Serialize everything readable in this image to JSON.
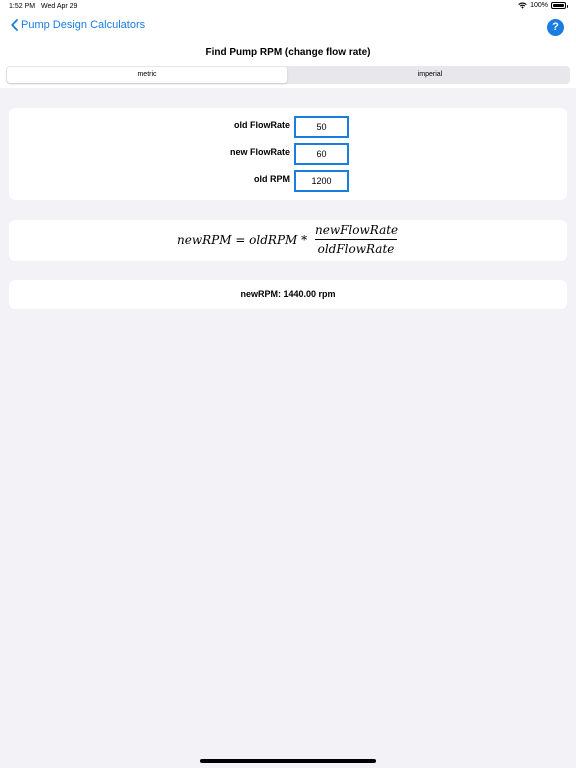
{
  "status_bar": {
    "time": "1:52 PM",
    "date": "Wed Apr 29",
    "battery": "100%"
  },
  "nav": {
    "back_label": "Pump Design Calculators",
    "help_label": "?"
  },
  "title": "Find Pump RPM (change flow rate)",
  "units": {
    "options": [
      "metric",
      "imperial"
    ],
    "selected": "metric"
  },
  "inputs": [
    {
      "label": "old FlowRate",
      "value": "50"
    },
    {
      "label": "new FlowRate",
      "value": "60"
    },
    {
      "label": "old RPM",
      "value": "1200"
    }
  ],
  "formula": {
    "lhs": "newRPM = oldRPM  *",
    "numerator": "newFlowRate",
    "denominator": "oldFlowRate"
  },
  "result": "newRPM:  1440.00 rpm",
  "colors": {
    "accent": "#1a7ee0",
    "background": "#f2f2f7"
  }
}
